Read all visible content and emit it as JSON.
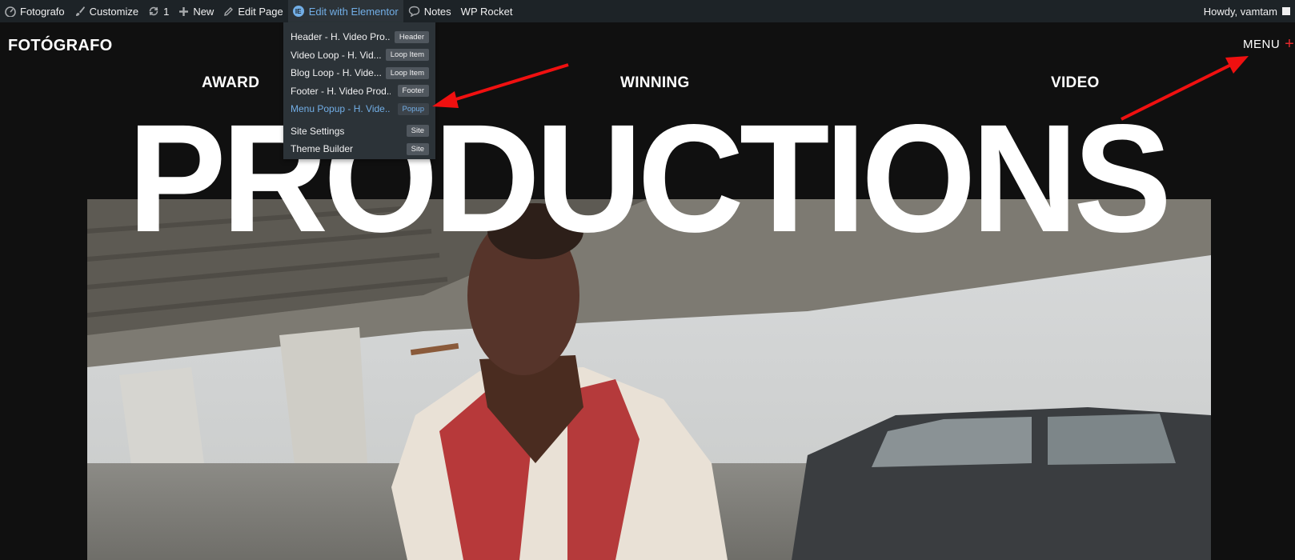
{
  "adminbar": {
    "site_name": "Fotografo",
    "customize": "Customize",
    "updates_count": "1",
    "new": "New",
    "edit_page": "Edit Page",
    "edit_elementor": "Edit with Elementor",
    "notes": "Notes",
    "wp_rocket": "WP Rocket",
    "howdy": "Howdy, vamtam"
  },
  "elementor_dropdown": {
    "items": [
      {
        "label": "Header - H. Video Pro...",
        "tag": "Header"
      },
      {
        "label": "Video Loop - H. Vid...",
        "tag": "Loop Item"
      },
      {
        "label": "Blog Loop - H. Vide...",
        "tag": "Loop Item"
      },
      {
        "label": "Footer - H. Video Prod...",
        "tag": "Footer"
      },
      {
        "label": "Menu Popup - H. Vide...",
        "tag": "Popup"
      }
    ],
    "settings": [
      {
        "label": "Site Settings",
        "tag": "Site"
      },
      {
        "label": "Theme Builder",
        "tag": "Site"
      }
    ]
  },
  "header": {
    "logo": "FOTÓGRAFO",
    "menu": "MENU",
    "menu_plus": "+"
  },
  "hero": {
    "word1": "AWARD",
    "word2": "WINNING",
    "word3": "VIDEO",
    "title": "PRODUCTIONS"
  },
  "colors": {
    "adminbar_bg": "#1d2327",
    "highlight": "#72aee6",
    "page_bg": "#101010",
    "accent_red": "#e2282b"
  }
}
